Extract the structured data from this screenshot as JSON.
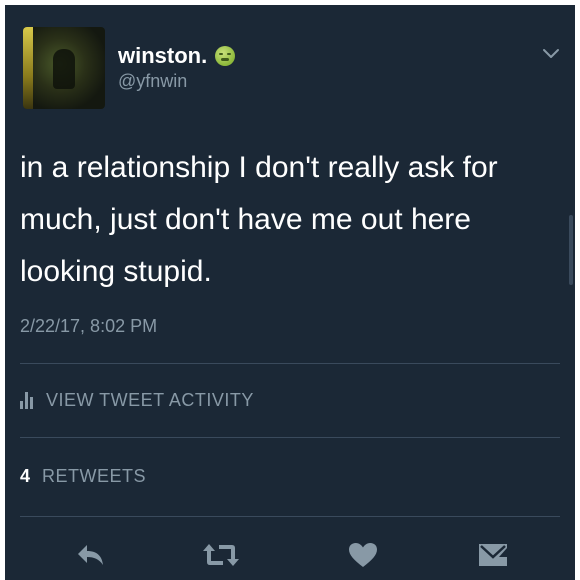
{
  "tweet": {
    "display_name": "winston.",
    "handle": "@yfnwin",
    "name_emoji_icon": "nauseated-face-icon",
    "text": "in a relationship I don't really ask for much, just don't have me out here looking stupid.",
    "timestamp": "2/22/17, 8:02 PM"
  },
  "activity": {
    "icon": "bar-chart-icon",
    "label": "VIEW TWEET ACTIVITY"
  },
  "stats": {
    "retweet_count": "4",
    "retweet_label": "RETWEETS"
  },
  "actions": {
    "reply_icon": "reply-icon",
    "retweet_icon": "retweet-icon",
    "like_icon": "heart-icon",
    "message_icon": "direct-message-icon"
  },
  "colors": {
    "background": "#1b2836",
    "primary_text": "#ffffff",
    "secondary_text": "#8899a6",
    "divider": "#3a4a5c"
  }
}
